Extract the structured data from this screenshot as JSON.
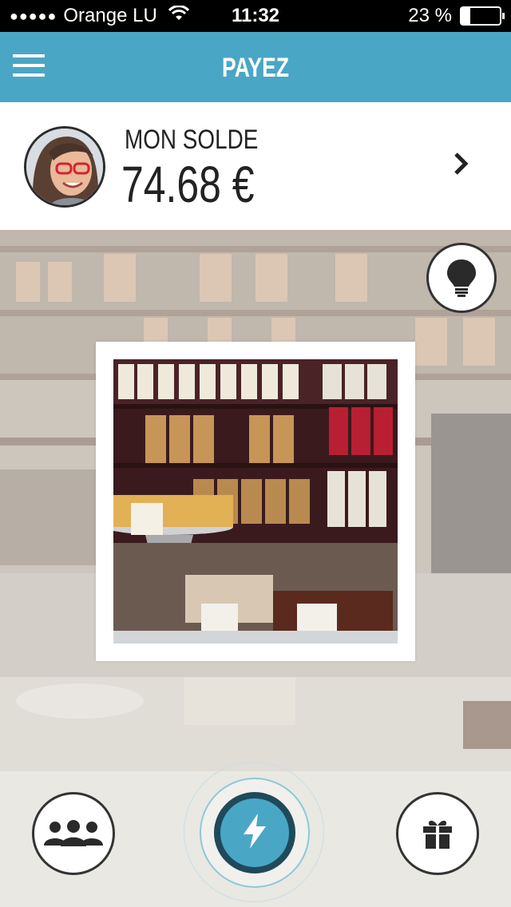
{
  "status_bar": {
    "signal": "●●●●●",
    "carrier": "Orange LU",
    "time": "11:32",
    "battery_text": "23 %",
    "battery_level": 0.23
  },
  "header": {
    "title": "PAYEZ",
    "menu_icon": "hamburger-menu-icon",
    "color": "#4aa6c5"
  },
  "balance": {
    "label": "MON SOLDE",
    "amount": "74.68 €",
    "chevron_icon": "chevron-right-icon"
  },
  "main": {
    "tip_icon": "lightbulb-icon"
  },
  "bottom_bar": {
    "friends_icon": "group-icon",
    "pay_icon": "lightning-bolt-icon",
    "gift_icon": "gift-icon",
    "accent": "#4aa6c5",
    "dark": "#1f4a5a"
  }
}
